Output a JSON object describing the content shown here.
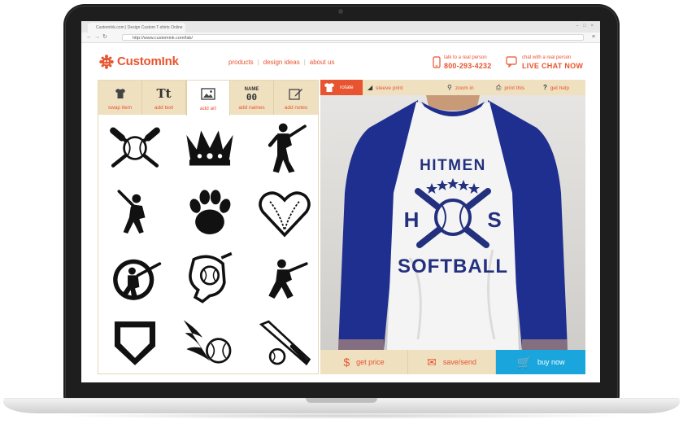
{
  "browser": {
    "tab_title": "CustomInk.com | Design Custom T-shirts Online",
    "url": "http://www.customink.com/lab/"
  },
  "site": {
    "logo": "CustomInk",
    "nav": [
      "products",
      "design ideas",
      "about us"
    ],
    "phone_label": "talk to a real person",
    "phone_number": "800-293-4232",
    "chat_label": "chat with a real person",
    "chat_cta": "LIVE CHAT NOW"
  },
  "editor_tabs": [
    {
      "label": "swap item",
      "icon": "shirt-icon"
    },
    {
      "label": "add text",
      "icon": "Tt"
    },
    {
      "label": "add art",
      "icon": "image-icon",
      "active": true
    },
    {
      "label": "add names",
      "icon_top": "NAME",
      "icon_bottom": "00"
    },
    {
      "label": "add notes",
      "icon": "notes-icon"
    }
  ],
  "art_items": [
    "crossed-bats-baseball",
    "crown",
    "batter-swinging",
    "batter-ready",
    "paw-print",
    "baseball-heart",
    "baseball-player-circle",
    "glove-and-ball",
    "batter-silhouette",
    "home-plate",
    "flaming-baseball",
    "bat-and-ball"
  ],
  "preview_tools": [
    "rotate",
    "sleeve print",
    "zoom in",
    "print this",
    "get help"
  ],
  "design": {
    "top_text": "HITMEN",
    "left_letter": "H",
    "right_letter": "S",
    "bottom_text": "SOFTBALL",
    "shirt_body_color": "#f4f4f4",
    "sleeve_color": "#1f2f8f",
    "ink_color": "#23307e"
  },
  "actions": {
    "get_price": "get price",
    "save_send": "save/send",
    "buy_now": "buy now"
  },
  "colors": {
    "brand": "#e8542f",
    "tab_bg": "#efe0c0",
    "buy": "#1aa6dd"
  }
}
